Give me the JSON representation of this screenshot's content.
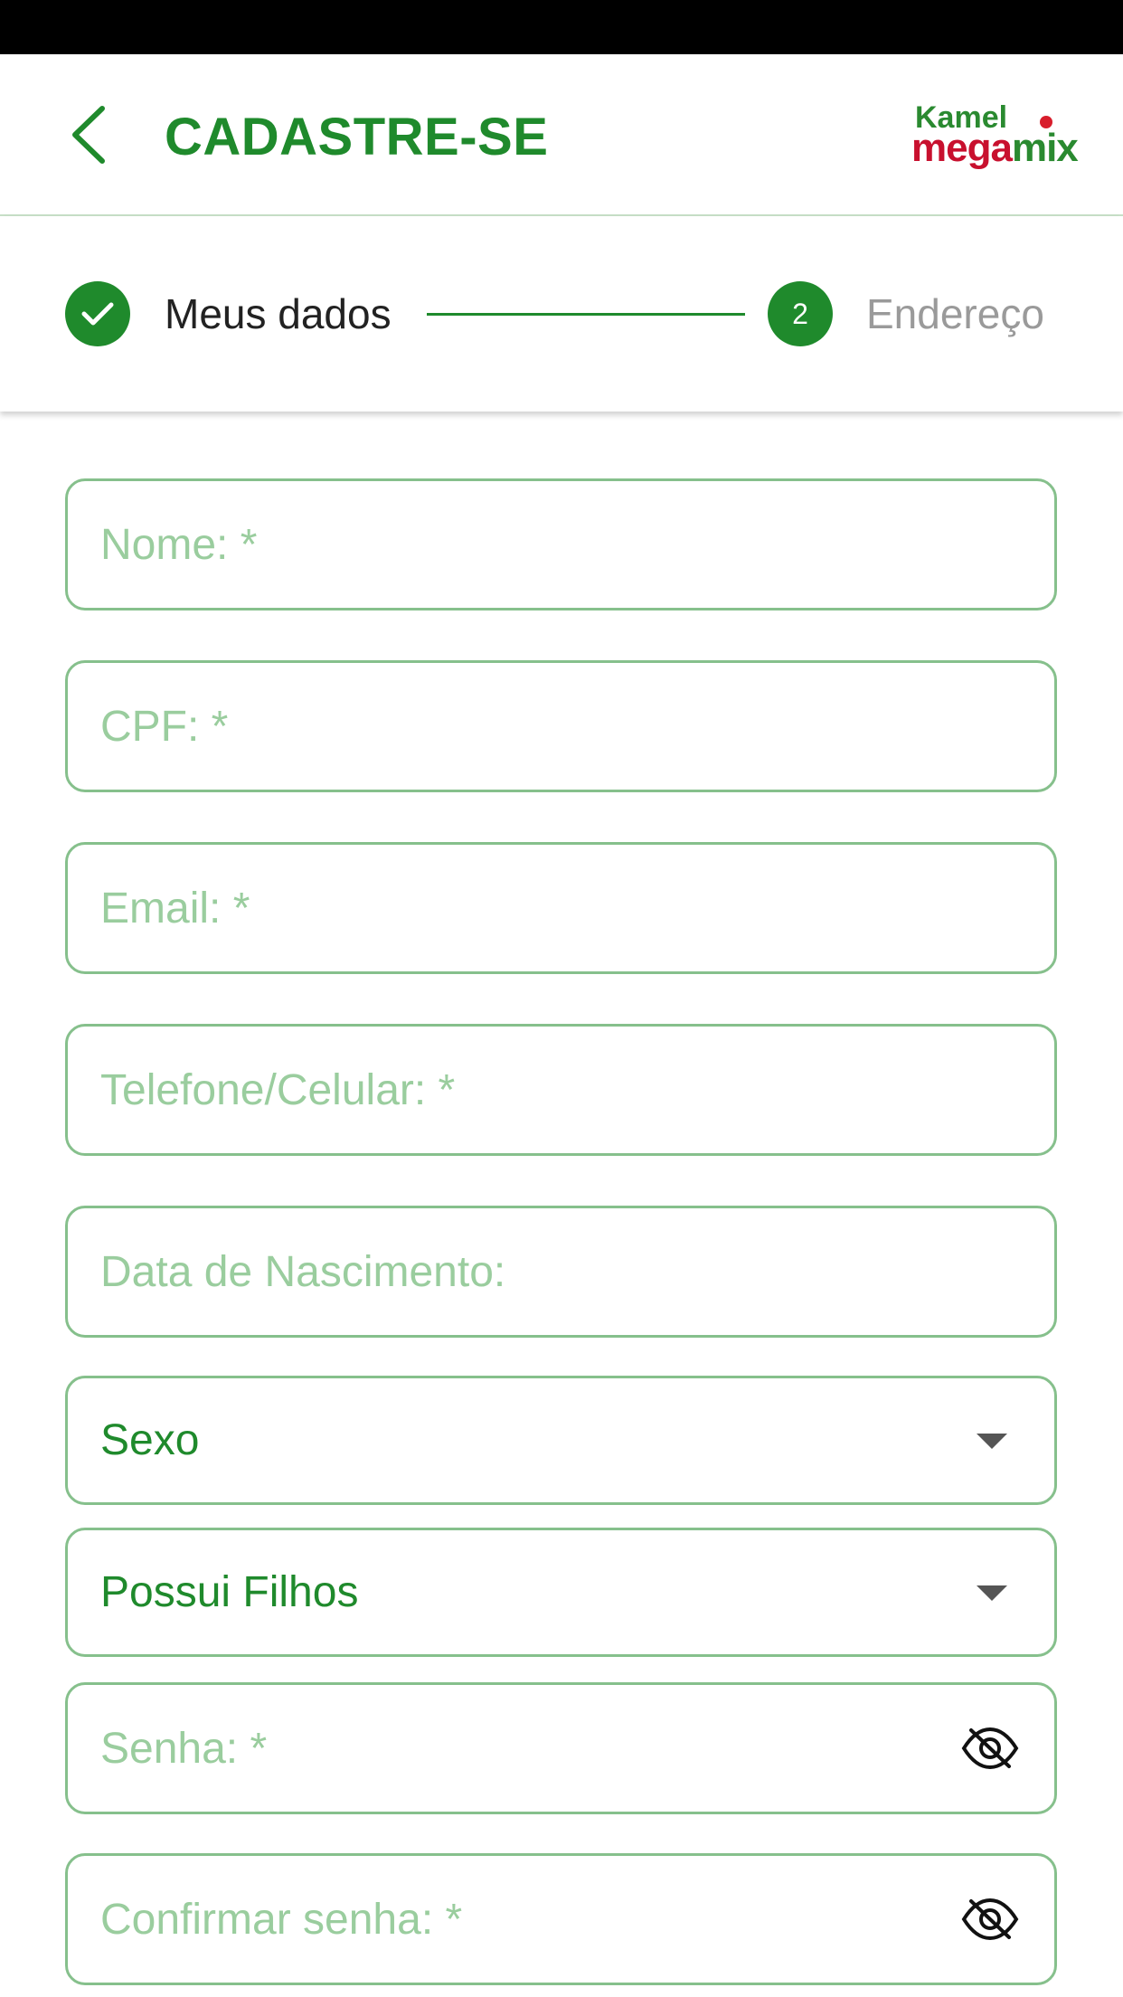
{
  "header": {
    "title": "CADASTRE-SE",
    "brand_top": "Kamel",
    "brand_bottom_main": "mega",
    "brand_bottom_accent": "mix",
    "colors": {
      "primary": "#1f8a2c",
      "brand_red": "#c8102e"
    }
  },
  "stepper": {
    "steps": [
      {
        "label": "Meus dados",
        "state": "completed",
        "icon": "check-icon"
      },
      {
        "label": "Endereço",
        "number": "2",
        "state": "upcoming"
      }
    ]
  },
  "form": {
    "name_placeholder": "Nome: *",
    "cpf_placeholder": "CPF: *",
    "email_placeholder": "Email: *",
    "phone_placeholder": "Telefone/Celular: *",
    "birthdate_placeholder": "Data de Nascimento:",
    "gender_select": "Sexo",
    "children_select": "Possui Filhos",
    "password_placeholder": "Senha: *",
    "confirm_password_placeholder": "Confirmar senha: *"
  }
}
